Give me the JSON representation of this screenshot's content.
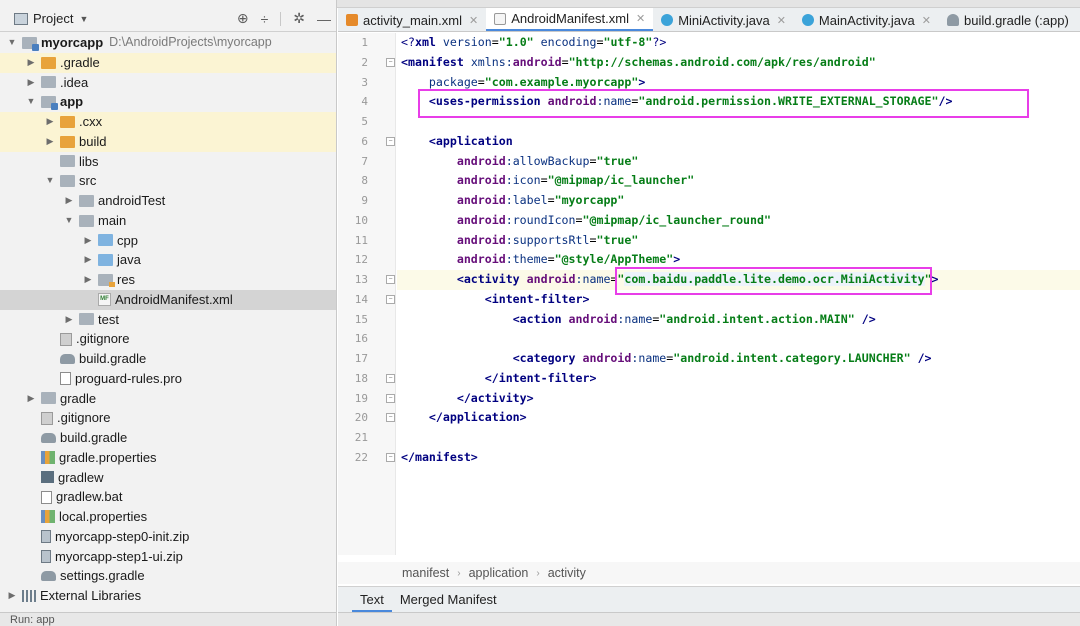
{
  "project_panel": {
    "title": "Project",
    "tree": [
      {
        "label": "myorcapp",
        "path": "D:\\AndroidProjects\\myorcapp",
        "indent": 0,
        "toggle": "open",
        "icon": "folder-module",
        "bold": true,
        "hl": ""
      },
      {
        "label": ".gradle",
        "indent": 1,
        "toggle": "closed",
        "icon": "folder-orange",
        "hl": "yellow"
      },
      {
        "label": ".idea",
        "indent": 1,
        "toggle": "closed",
        "icon": "folder",
        "hl": ""
      },
      {
        "label": "app",
        "indent": 1,
        "toggle": "open",
        "icon": "folder-module",
        "bold": true,
        "hl": ""
      },
      {
        "label": ".cxx",
        "indent": 2,
        "toggle": "closed",
        "icon": "folder-orange",
        "hl": "yellow"
      },
      {
        "label": "build",
        "indent": 2,
        "toggle": "closed",
        "icon": "folder-orange",
        "hl": "yellow"
      },
      {
        "label": "libs",
        "indent": 2,
        "toggle": "none",
        "icon": "folder",
        "hl": ""
      },
      {
        "label": "src",
        "indent": 2,
        "toggle": "open",
        "icon": "folder",
        "hl": ""
      },
      {
        "label": "androidTest",
        "indent": 3,
        "toggle": "closed",
        "icon": "folder",
        "hl": ""
      },
      {
        "label": "main",
        "indent": 3,
        "toggle": "open",
        "icon": "folder",
        "hl": ""
      },
      {
        "label": "cpp",
        "indent": 4,
        "toggle": "closed",
        "icon": "folder-blue",
        "hl": ""
      },
      {
        "label": "java",
        "indent": 4,
        "toggle": "closed",
        "icon": "folder-blue",
        "hl": ""
      },
      {
        "label": "res",
        "indent": 4,
        "toggle": "closed",
        "icon": "folder-res",
        "hl": ""
      },
      {
        "label": "AndroidManifest.xml",
        "indent": 4,
        "toggle": "none",
        "icon": "xml",
        "hl": "selected"
      },
      {
        "label": "test",
        "indent": 3,
        "toggle": "closed",
        "icon": "folder",
        "hl": ""
      },
      {
        "label": ".gitignore",
        "indent": 2,
        "toggle": "none",
        "icon": "git",
        "hl": ""
      },
      {
        "label": "build.gradle",
        "indent": 2,
        "toggle": "none",
        "icon": "gradle",
        "hl": ""
      },
      {
        "label": "proguard-rules.pro",
        "indent": 2,
        "toggle": "none",
        "icon": "file",
        "hl": ""
      },
      {
        "label": "gradle",
        "indent": 1,
        "toggle": "closed",
        "icon": "folder",
        "hl": ""
      },
      {
        "label": ".gitignore",
        "indent": 1,
        "toggle": "none",
        "icon": "git",
        "hl": ""
      },
      {
        "label": "build.gradle",
        "indent": 1,
        "toggle": "none",
        "icon": "gradle",
        "hl": ""
      },
      {
        "label": "gradle.properties",
        "indent": 1,
        "toggle": "none",
        "icon": "props",
        "hl": ""
      },
      {
        "label": "gradlew",
        "indent": 1,
        "toggle": "none",
        "icon": "term",
        "hl": ""
      },
      {
        "label": "gradlew.bat",
        "indent": 1,
        "toggle": "none",
        "icon": "file",
        "hl": ""
      },
      {
        "label": "local.properties",
        "indent": 1,
        "toggle": "none",
        "icon": "props",
        "hl": ""
      },
      {
        "label": "myorcapp-step0-init.zip",
        "indent": 1,
        "toggle": "none",
        "icon": "zip",
        "hl": ""
      },
      {
        "label": "myorcapp-step1-ui.zip",
        "indent": 1,
        "toggle": "none",
        "icon": "zip",
        "hl": ""
      },
      {
        "label": "settings.gradle",
        "indent": 1,
        "toggle": "none",
        "icon": "gradle",
        "hl": ""
      },
      {
        "label": "External Libraries",
        "indent": 0,
        "toggle": "closed",
        "icon": "lib",
        "hl": ""
      }
    ],
    "bottom_label": "Run: app"
  },
  "editor_tabs": [
    {
      "label": "activity_main.xml",
      "icon": "xml-act",
      "active": false
    },
    {
      "label": "AndroidManifest.xml",
      "icon": "xml-man",
      "active": true
    },
    {
      "label": "MiniActivity.java",
      "icon": "class",
      "active": false
    },
    {
      "label": "MainActivity.java",
      "icon": "class",
      "active": false
    },
    {
      "label": "build.gradle (:app)",
      "icon": "gradle",
      "active": false
    }
  ],
  "code_lines": [
    {
      "n": "1",
      "tokens": [
        {
          "t": "pi",
          "v": "<?"
        },
        {
          "t": "tag",
          "v": "xml "
        },
        {
          "t": "attr",
          "v": "version"
        },
        {
          "t": "plain",
          "v": "="
        },
        {
          "t": "str",
          "v": "\"1.0\""
        },
        {
          "t": "plain",
          "v": " "
        },
        {
          "t": "attr",
          "v": "encoding"
        },
        {
          "t": "plain",
          "v": "="
        },
        {
          "t": "str",
          "v": "\"utf-8\""
        },
        {
          "t": "pi",
          "v": "?>"
        }
      ]
    },
    {
      "n": "2",
      "tokens": [
        {
          "t": "tag",
          "v": "<manifest "
        },
        {
          "t": "attr",
          "v": "xmlns:"
        },
        {
          "t": "attr-ns",
          "v": "android"
        },
        {
          "t": "plain",
          "v": "="
        },
        {
          "t": "str",
          "v": "\"http://schemas.android.com/apk/res/android\""
        }
      ]
    },
    {
      "n": "3",
      "tokens": [
        {
          "t": "plain",
          "v": "    "
        },
        {
          "t": "attr",
          "v": "package"
        },
        {
          "t": "plain",
          "v": "="
        },
        {
          "t": "str",
          "v": "\"com.example.myorcapp\""
        },
        {
          "t": "tag",
          "v": ">"
        }
      ]
    },
    {
      "n": "4",
      "tokens": [
        {
          "t": "plain",
          "v": "    "
        },
        {
          "t": "tag",
          "v": "<uses-permission "
        },
        {
          "t": "attr-ns",
          "v": "android"
        },
        {
          "t": "attr",
          "v": ":name"
        },
        {
          "t": "plain",
          "v": "="
        },
        {
          "t": "str",
          "v": "\"android.permission.WRITE_EXTERNAL_STORAGE\""
        },
        {
          "t": "tag",
          "v": "/>"
        }
      ]
    },
    {
      "n": "5",
      "tokens": []
    },
    {
      "n": "6",
      "tokens": [
        {
          "t": "plain",
          "v": "    "
        },
        {
          "t": "tag",
          "v": "<application"
        }
      ]
    },
    {
      "n": "7",
      "tokens": [
        {
          "t": "plain",
          "v": "        "
        },
        {
          "t": "attr-ns",
          "v": "android"
        },
        {
          "t": "attr",
          "v": ":allowBackup"
        },
        {
          "t": "plain",
          "v": "="
        },
        {
          "t": "str",
          "v": "\"true\""
        }
      ]
    },
    {
      "n": "8",
      "tokens": [
        {
          "t": "plain",
          "v": "        "
        },
        {
          "t": "attr-ns",
          "v": "android"
        },
        {
          "t": "attr",
          "v": ":icon"
        },
        {
          "t": "plain",
          "v": "="
        },
        {
          "t": "str",
          "v": "\"@mipmap/ic_launcher\""
        }
      ]
    },
    {
      "n": "9",
      "tokens": [
        {
          "t": "plain",
          "v": "        "
        },
        {
          "t": "attr-ns",
          "v": "android"
        },
        {
          "t": "attr",
          "v": ":label"
        },
        {
          "t": "plain",
          "v": "="
        },
        {
          "t": "str",
          "v": "\"myorcapp\""
        }
      ]
    },
    {
      "n": "10",
      "tokens": [
        {
          "t": "plain",
          "v": "        "
        },
        {
          "t": "attr-ns",
          "v": "android"
        },
        {
          "t": "attr",
          "v": ":roundIcon"
        },
        {
          "t": "plain",
          "v": "="
        },
        {
          "t": "str",
          "v": "\"@mipmap/ic_launcher_round\""
        }
      ]
    },
    {
      "n": "11",
      "tokens": [
        {
          "t": "plain",
          "v": "        "
        },
        {
          "t": "attr-ns",
          "v": "android"
        },
        {
          "t": "attr",
          "v": ":supportsRtl"
        },
        {
          "t": "plain",
          "v": "="
        },
        {
          "t": "str",
          "v": "\"true\""
        }
      ]
    },
    {
      "n": "12",
      "tokens": [
        {
          "t": "plain",
          "v": "        "
        },
        {
          "t": "attr-ns",
          "v": "android"
        },
        {
          "t": "attr",
          "v": ":theme"
        },
        {
          "t": "plain",
          "v": "="
        },
        {
          "t": "str",
          "v": "\"@style/AppTheme\""
        },
        {
          "t": "tag",
          "v": ">"
        }
      ]
    },
    {
      "n": "13",
      "current": true,
      "tokens": [
        {
          "t": "plain",
          "v": "        "
        },
        {
          "t": "tag",
          "v": "<activity "
        },
        {
          "t": "attr-ns",
          "v": "android"
        },
        {
          "t": "attr",
          "v": ":name"
        },
        {
          "t": "plain",
          "v": "="
        },
        {
          "t": "str",
          "v": "\""
        },
        {
          "t": "cls",
          "v": "com.baidu.paddle.lite.demo.ocr.MiniActivity"
        },
        {
          "t": "str",
          "v": "\""
        },
        {
          "t": "tag",
          "v": ">"
        }
      ]
    },
    {
      "n": "14",
      "tokens": [
        {
          "t": "plain",
          "v": "            "
        },
        {
          "t": "tag",
          "v": "<intent-filter>"
        }
      ]
    },
    {
      "n": "15",
      "tokens": [
        {
          "t": "plain",
          "v": "                "
        },
        {
          "t": "tag",
          "v": "<action "
        },
        {
          "t": "attr-ns",
          "v": "android"
        },
        {
          "t": "attr",
          "v": ":name"
        },
        {
          "t": "plain",
          "v": "="
        },
        {
          "t": "str",
          "v": "\"android.intent.action.MAIN\""
        },
        {
          "t": "plain",
          "v": " "
        },
        {
          "t": "tag",
          "v": "/>"
        }
      ]
    },
    {
      "n": "16",
      "tokens": []
    },
    {
      "n": "17",
      "tokens": [
        {
          "t": "plain",
          "v": "                "
        },
        {
          "t": "tag",
          "v": "<category "
        },
        {
          "t": "attr-ns",
          "v": "android"
        },
        {
          "t": "attr",
          "v": ":name"
        },
        {
          "t": "plain",
          "v": "="
        },
        {
          "t": "str",
          "v": "\"android.intent.category.LAUNCHER\""
        },
        {
          "t": "plain",
          "v": " "
        },
        {
          "t": "tag",
          "v": "/>"
        }
      ]
    },
    {
      "n": "18",
      "tokens": [
        {
          "t": "plain",
          "v": "            "
        },
        {
          "t": "tag",
          "v": "</intent-filter>"
        }
      ]
    },
    {
      "n": "19",
      "tokens": [
        {
          "t": "plain",
          "v": "        "
        },
        {
          "t": "tag",
          "v": "</activity>"
        }
      ]
    },
    {
      "n": "20",
      "tokens": [
        {
          "t": "plain",
          "v": "    "
        },
        {
          "t": "tag",
          "v": "</application>"
        }
      ]
    },
    {
      "n": "21",
      "tokens": []
    },
    {
      "n": "22",
      "tokens": [
        {
          "t": "tag",
          "v": "</manifest>"
        }
      ]
    }
  ],
  "fold_lines": [
    2,
    6,
    13,
    14,
    18,
    19,
    20,
    22
  ],
  "breadcrumb": [
    "manifest",
    "application",
    "activity"
  ],
  "bottom_tabs": [
    {
      "label": "Text",
      "active": true
    },
    {
      "label": "Merged Manifest",
      "active": false
    }
  ],
  "highlight_color": "#e83ee8"
}
